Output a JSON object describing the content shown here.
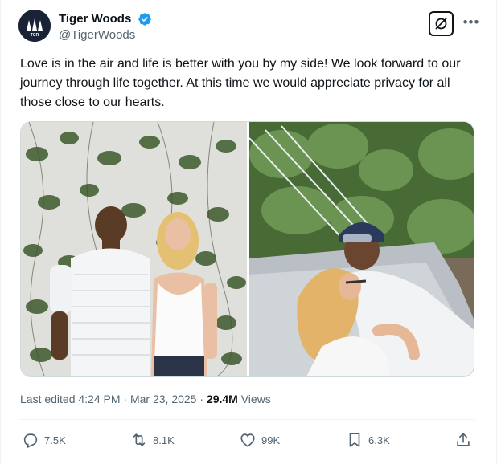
{
  "author": {
    "display_name": "Tiger Woods",
    "handle": "@TigerWoods",
    "avatar_text": "TGR",
    "verified": true
  },
  "tweet": {
    "text": "Love is in the air and life is better with you by my side! We look forward to our journey through life together. At this time we would appreciate privacy for all those close to our hearts."
  },
  "meta": {
    "edited_label": "Last edited 4:24 PM · Mar 23, 2025 · ",
    "views_count": "29.4M",
    "views_label": " Views"
  },
  "actions": {
    "replies": "7.5K",
    "retweets": "8.1K",
    "likes": "99K",
    "bookmarks": "6.3K"
  },
  "icons": {
    "verified": "verified-badge-icon",
    "grok": "grok-icon",
    "more": "more-icon",
    "reply": "reply-icon",
    "retweet": "retweet-icon",
    "like": "heart-icon",
    "bookmark": "bookmark-icon",
    "share": "share-icon"
  },
  "colors": {
    "text": "#0f1419",
    "secondary": "#536471",
    "verified": "#1d9bf0",
    "avatar_bg": "#1a2336"
  }
}
